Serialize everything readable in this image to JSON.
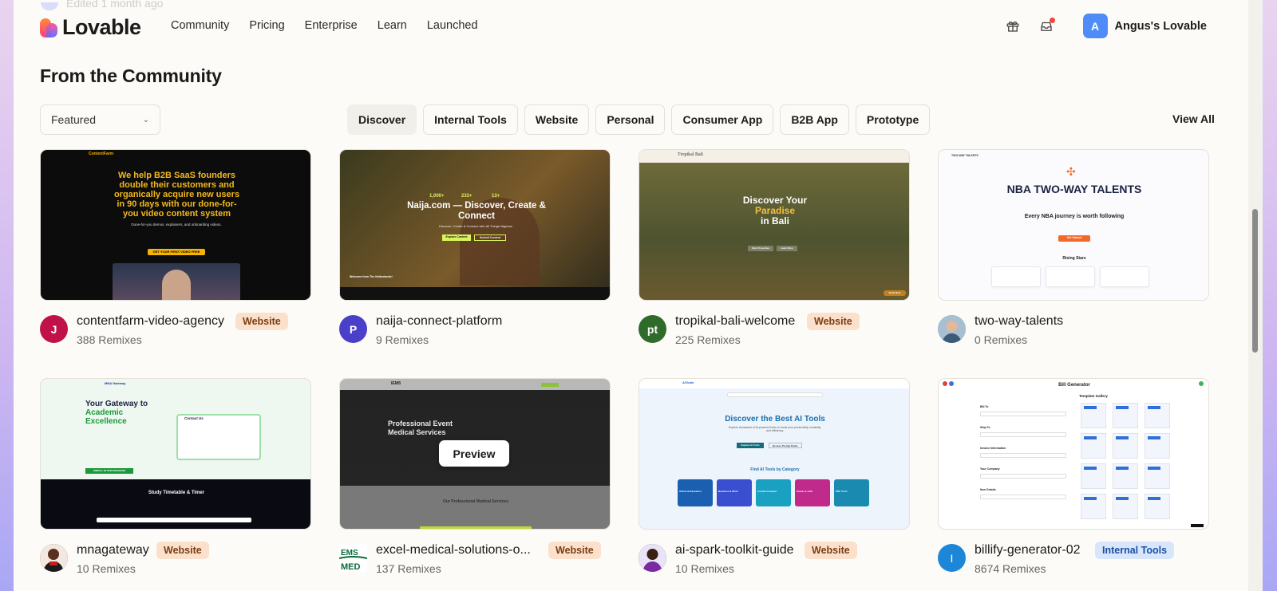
{
  "header": {
    "ghost_text": "Edited 1 month ago",
    "logo_text": "Lovable",
    "nav": [
      "Community",
      "Pricing",
      "Enterprise",
      "Learn",
      "Launched"
    ],
    "account_initial": "A",
    "account_name": "Angus's Lovable"
  },
  "section": {
    "title": "From the Community",
    "sort_select": "Featured",
    "filters": [
      "Discover",
      "Internal Tools",
      "Website",
      "Personal",
      "Consumer App",
      "B2B App",
      "Prototype"
    ],
    "active_filter": "Discover",
    "view_all": "View All"
  },
  "cards": [
    {
      "name": "contentfarm-video-agency",
      "remixes": "388 Remixes",
      "badge": "Website",
      "avatar": "J",
      "avatar_color": "#c0114a",
      "thumb": {
        "brand": "ContentFarm",
        "headline": "We help B2B SaaS founders double their customers and organically acquire new users in 90 days with our done-for-you video content system",
        "sub": "Done-for-you demos, explainers, and onboarding videos.",
        "cta": "GET YOUR FIRST VIDEO FREE"
      }
    },
    {
      "name": "naija-connect-platform",
      "remixes": "9 Remixes",
      "badge": "",
      "avatar": "P",
      "avatar_color": "#4a3fc8",
      "thumb": {
        "headline": "Naija.com — Discover, Create & Connect",
        "stat1": "1,000+",
        "stat2": "233+",
        "stat3": "13+",
        "sub": "Discover, Create & Connect with All Things Nigerian",
        "cta1": "Explore Content",
        "cta2": "Submit Content",
        "banner": "Welcome from The Netherlands!"
      }
    },
    {
      "name": "tropikal-bali-welcome",
      "remixes": "225 Remixes",
      "badge": "Website",
      "avatar": "pt",
      "avatar_color": "#2f6b2a",
      "thumb": {
        "brand": "Tropikal Bali",
        "line1": "Discover Your",
        "line2": "Paradise",
        "line3": "in Bali",
        "cta1": "View Properties",
        "cta2": "Learn More",
        "corner": "Book Now"
      }
    },
    {
      "name": "two-way-talents",
      "remixes": "0 Remixes",
      "badge": "",
      "avatar": "",
      "avatar_color": "#8fa8bd",
      "thumb": {
        "brand": "TWO-WAY TALENTS",
        "headline": "NBA TWO-WAY TALENTS",
        "sub": "Every NBA journey is worth following",
        "cta": "Get Started",
        "section": "Rising Stars"
      }
    },
    {
      "name": "mnagateway",
      "remixes": "10 Remixes",
      "badge": "Website",
      "avatar": "",
      "avatar_color": "#3a2218",
      "thumb": {
        "brand": "MNA Gateway",
        "line1": "Your Gateway to",
        "line2": "Academic Excellence",
        "contact": "Contact Us",
        "section": "Study Timetable & Timer",
        "cta": "ENROLL IN OUR PROGRAM"
      }
    },
    {
      "name": "excel-medical-solutions-o...",
      "remixes": "137 Remixes",
      "badge": "Website",
      "avatar": "EMS MED",
      "avatar_color": "#ffffff",
      "thumb": {
        "brand": "IEMS",
        "line1": "Professional Event",
        "line2": "Medical Services",
        "section": "Our Professional Medical Services",
        "preview": "Preview"
      }
    },
    {
      "name": "ai-spark-toolkit-guide",
      "remixes": "10 Remixes",
      "badge": "Website",
      "avatar": "",
      "avatar_color": "#2a1a14",
      "thumb": {
        "brand": "AITools",
        "headline": "Discover the Best AI Tools",
        "sub": "Explore thousands of AI-powered tools to boost your productivity, creativity, and efficiency.",
        "cta1": "Explore AI Tools",
        "cta2": "Browse Prompt Packs",
        "section": "Find AI Tools by Category",
        "cats": [
          "Online & Education",
          "Business & Work",
          "Content Creation",
          "Career & Jobs",
          "PDF Tools"
        ]
      }
    },
    {
      "name": "billify-generator-02",
      "remixes": "8674 Remixes",
      "badge": "Internal Tools",
      "avatar": "I",
      "avatar_color": "#1d86d6",
      "thumb": {
        "title": "Bill Generator",
        "gallery": "Template Gallery",
        "f1": "Bill To",
        "f2": "Ship To",
        "f3": "Invoice Information",
        "f4": "Your Company",
        "f5": "Item Details"
      }
    }
  ],
  "colors": {
    "accent_blue": "#4f8cf7",
    "page_bg": "#fcfbf8",
    "website_badge": "#fbe1cc",
    "internal_badge": "#d8e6fb"
  }
}
